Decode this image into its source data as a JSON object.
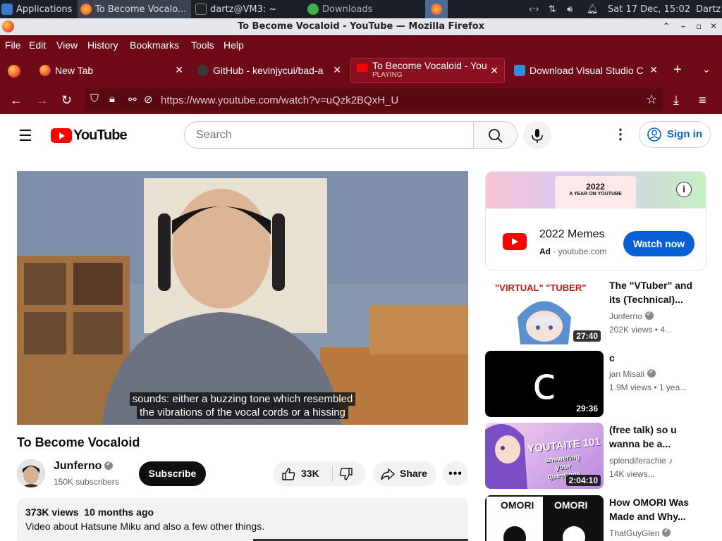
{
  "taskbar": {
    "applications_label": "Applications",
    "window_buttons": [
      {
        "label": "To Become Vocalo..."
      },
      {
        "label": "dartz@VM3: ~"
      },
      {
        "label": "Downloads"
      }
    ],
    "datetime": "Sat 17 Dec, 15:02",
    "user": "Dartz"
  },
  "window": {
    "title": "To Become Vocaloid - YouTube — Mozilla Firefox"
  },
  "menu": {
    "items": [
      "File",
      "Edit",
      "View",
      "History",
      "Bookmarks",
      "Tools",
      "Help"
    ]
  },
  "tabs": [
    {
      "label": "New Tab"
    },
    {
      "label": "GitHub - kevinjycui/bad-a"
    },
    {
      "label": "To Become Vocaloid - You",
      "sublabel": "PLAYING",
      "active": true
    },
    {
      "label": "Download Visual Studio C"
    }
  ],
  "navbar": {
    "url": "https://www.youtube.com/watch?v=uQzk2BQxH_U"
  },
  "youtube": {
    "logo_text": "YouTube",
    "search_placeholder": "Search",
    "sign_in": "Sign in",
    "player": {
      "caption_line1": "sounds: either a buzzing tone which resembled",
      "caption_line2": "the vibrations of the vocal cords or a hissing"
    },
    "video": {
      "title": "To Become Vocaloid",
      "channel": "Junferno",
      "subscribers": "150K subscribers",
      "subscribe_label": "Subscribe",
      "likes": "33K",
      "share_label": "Share",
      "views": "373K views",
      "age": "10 months ago",
      "description": "Video about Hatsune Miku and also a few other things."
    },
    "ad": {
      "banner_year": "2022",
      "banner_tagline": "A YEAR ON YOUTUBE",
      "title": "2022 Memes",
      "ad_label": "Ad",
      "domain": "youtube.com",
      "cta": "Watch now"
    },
    "recommendations": [
      {
        "thumb_text": "\"VIRTUAL\" \"TUBER\"",
        "duration": "27:40",
        "title": "The \"VTuber\" and its (Technical)...",
        "channel": "Junferno",
        "verified": true,
        "meta": "202K views • 4..."
      },
      {
        "thumb_text": "c",
        "duration": "29:36",
        "title": "c",
        "channel": "jan Misali",
        "verified": true,
        "meta": "1.9M views • 1 yea..."
      },
      {
        "thumb_text": "YOUTAITE 101",
        "thumb_sub": "answering your questions",
        "duration": "2:04:10",
        "title": "(free talk) so u wanna be a...",
        "channel": "splendiferachie",
        "verified": false,
        "music": true,
        "meta": "14K views..."
      },
      {
        "thumb_text": "OMORI",
        "duration": "",
        "title": "How OMORI Was Made and Why...",
        "channel": "ThatGuyGlen",
        "verified": true,
        "meta": ""
      }
    ]
  }
}
